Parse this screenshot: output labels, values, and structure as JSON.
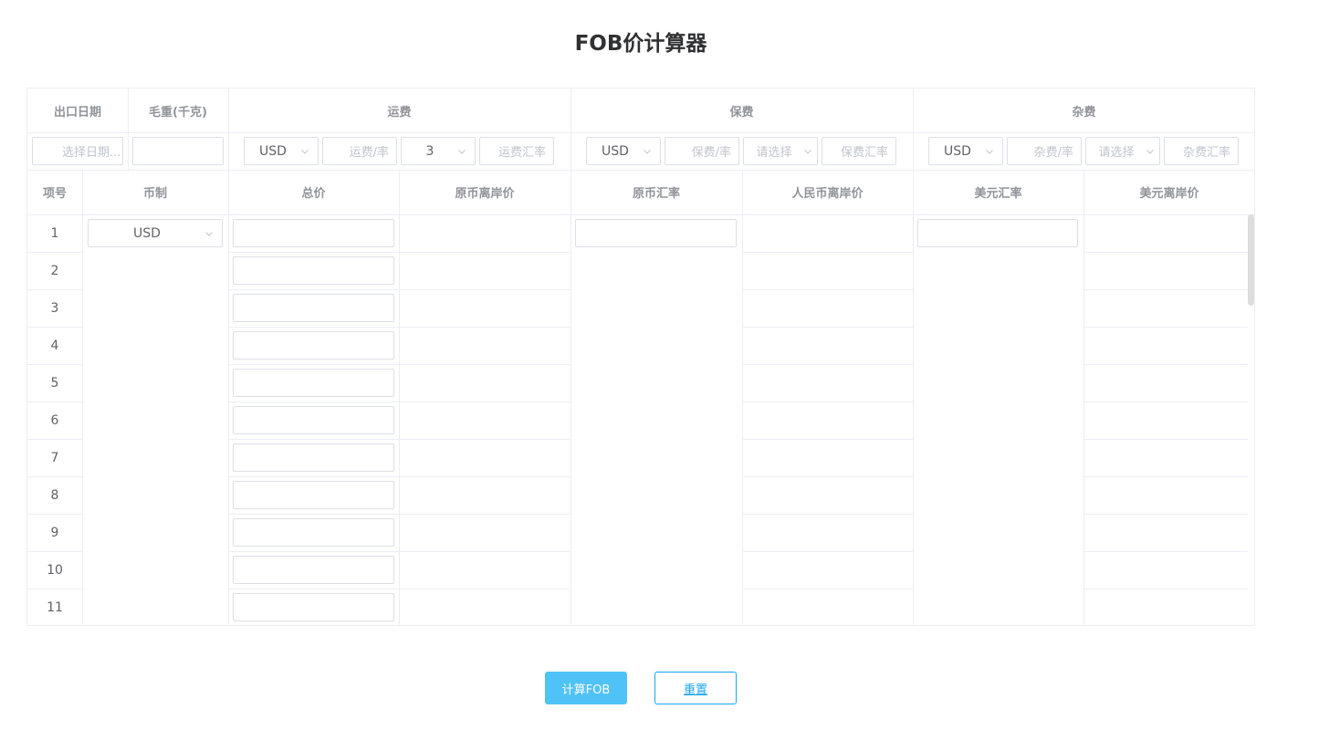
{
  "title": "FOB价计算器",
  "top_headers": {
    "export_date": "出口日期",
    "gross_weight": "毛重(千克)",
    "freight": "运费",
    "insurance": "保费",
    "misc": "杂费"
  },
  "top_inputs": {
    "date_placeholder": "选择日期...",
    "freight_currency": "USD",
    "freight_rate_placeholder": "运费/率",
    "freight_type": "3",
    "freight_exchange_placeholder": "运费汇率",
    "insurance_currency": "USD",
    "insurance_rate_placeholder": "保费/率",
    "insurance_type_placeholder": "请选择",
    "insurance_exchange_placeholder": "保费汇率",
    "misc_currency": "USD",
    "misc_rate_placeholder": "杂费/率",
    "misc_type_placeholder": "请选择",
    "misc_exchange_placeholder": "杂费汇率"
  },
  "columns": [
    "项号",
    "币制",
    "总价",
    "原币离岸价",
    "原币汇率",
    "人民币离岸价",
    "美元汇率",
    "美元离岸价"
  ],
  "row_numbers": [
    "1",
    "2",
    "3",
    "4",
    "5",
    "6",
    "7",
    "8",
    "9",
    "10",
    "11"
  ],
  "currency_value": "USD",
  "buttons": {
    "calculate": "计算FOB",
    "reset": "重置"
  }
}
